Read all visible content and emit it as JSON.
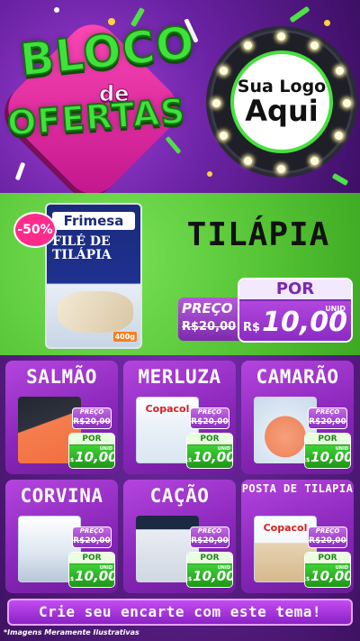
{
  "header": {
    "logo_line1": "BLOCO",
    "logo_line2": "de",
    "logo_line3": "OFERTAS",
    "badge_line1": "Sua Logo",
    "badge_line2": "Aqui"
  },
  "hero": {
    "discount": "-50%",
    "product_brand": "Frimesa",
    "product_name": "FILÉ DE TILÁPIA",
    "product_weight": "400g",
    "title": "TILÁPIA",
    "preco_label": "PREÇO",
    "old_price": "R$20,00",
    "por_label": "POR",
    "unit": "UNID",
    "currency": "R$",
    "new_price": "10,00"
  },
  "cards": [
    {
      "name": "SALMÃO",
      "preco_label": "PREÇO",
      "old_price": "R$20,00",
      "por_label": "POR",
      "unit": "UNID",
      "currency": "R$",
      "new_price": "10,00",
      "brand": ""
    },
    {
      "name": "MERLUZA",
      "preco_label": "PREÇO",
      "old_price": "R$20,00",
      "por_label": "POR",
      "unit": "UNID",
      "currency": "R$",
      "new_price": "10,00",
      "brand": "Copacol"
    },
    {
      "name": "CAMARÃO",
      "preco_label": "PREÇO",
      "old_price": "R$20,00",
      "por_label": "POR",
      "unit": "UNID",
      "currency": "R$",
      "new_price": "10,00",
      "brand": ""
    },
    {
      "name": "CORVINA",
      "preco_label": "PREÇO",
      "old_price": "R$20,00",
      "por_label": "POR",
      "unit": "UNID",
      "currency": "R$",
      "new_price": "10,00",
      "brand": ""
    },
    {
      "name": "CAÇÃO",
      "preco_label": "PREÇO",
      "old_price": "R$20,00",
      "por_label": "POR",
      "unit": "UNID",
      "currency": "R$",
      "new_price": "10,00",
      "brand": ""
    },
    {
      "name": "POSTA DE TILAPIA",
      "preco_label": "PREÇO",
      "old_price": "R$20,00",
      "por_label": "POR",
      "unit": "UNID",
      "currency": "R$",
      "new_price": "10,00",
      "brand": "Copacol"
    }
  ],
  "footer": {
    "cta": "Crie seu encarte com este tema!",
    "note": "*Imagens Meramente Ilustrativas"
  },
  "colors": {
    "accent_green": "#3ee23b",
    "accent_purple": "#8a27bb",
    "accent_pink": "#ff2b8a"
  }
}
